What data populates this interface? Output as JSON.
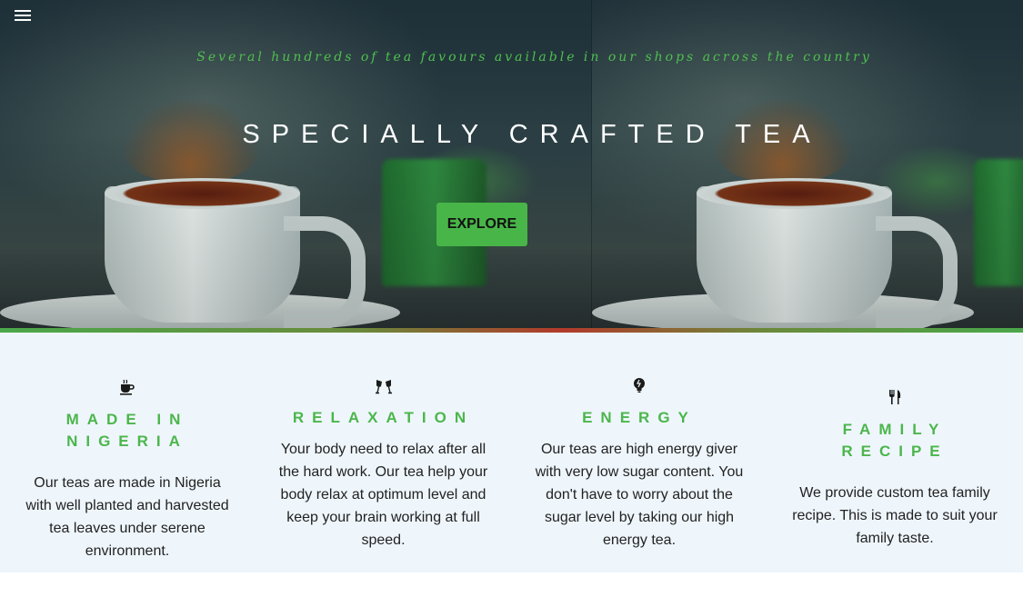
{
  "hero": {
    "menu_icon": "hamburger-menu-icon",
    "tagline": "Several hundreds of tea favours available in our shops across the country",
    "headline": "SPECIALLY CRAFTED TEA",
    "explore_label": "EXPLORE",
    "accent_color": "#48b548"
  },
  "features": [
    {
      "icon": "coffee-cup-icon",
      "title": "MADE IN NIGERIA",
      "text": "Our teas are made in Nigeria with well planted and harvested tea leaves under serene environment."
    },
    {
      "icon": "glasses-cheers-icon",
      "title": "RELAXATION",
      "text": "Your body need to relax after all the hard work. Our tea help your body relax at optimum level and keep your brain working at full speed."
    },
    {
      "icon": "energy-bulb-icon",
      "title": "ENERGY",
      "text": "Our teas are high energy giver with very low sugar content. You don't have to worry about the sugar level by taking our high energy tea."
    },
    {
      "icon": "fork-knife-icon",
      "title": "FAMILY RECIPE",
      "text": "We provide custom tea family recipe. This is made to suit your family taste."
    }
  ]
}
